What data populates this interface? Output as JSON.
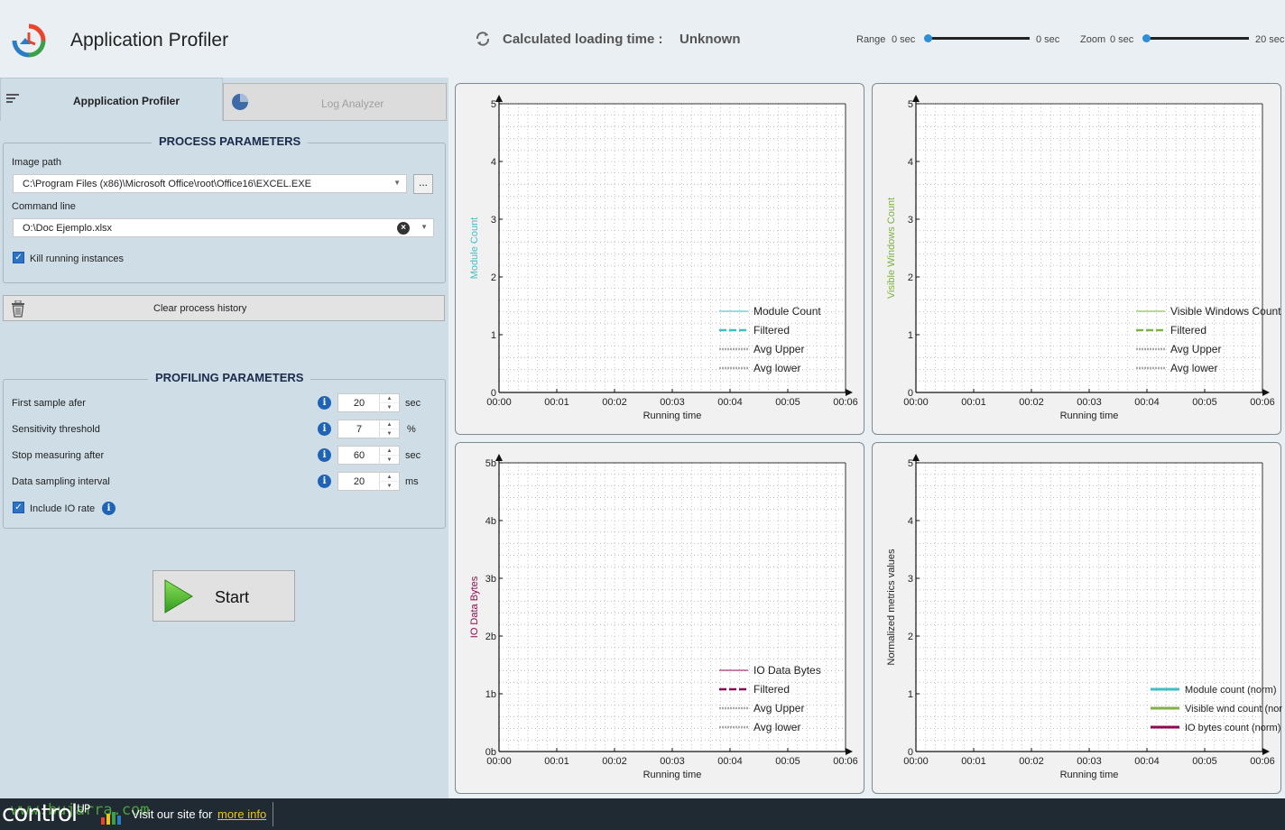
{
  "header": {
    "app_title": "Application Profiler",
    "loading_label": "Calculated loading time :",
    "loading_value": "Unknown",
    "range": {
      "label": "Range",
      "min": "0 sec",
      "max": "0 sec",
      "position": 0.0
    },
    "zoom": {
      "label": "Zoom",
      "min": "0 sec",
      "max": "20 sec",
      "position": 0.0
    }
  },
  "tabs": [
    {
      "label": "Appplication Profiler",
      "active": true
    },
    {
      "label": "Log Analyzer",
      "active": false
    }
  ],
  "process_parameters": {
    "title": "PROCESS PARAMETERS",
    "image_path_label": "Image path",
    "image_path_value": "C:\\Program Files (x86)\\Microsoft Office\\root\\Office16\\EXCEL.EXE",
    "browse_label": "...",
    "command_line_label": "Command line",
    "command_line_value": "O:\\Doc Ejemplo.xlsx",
    "kill_label": "Kill running instances",
    "kill_checked": true
  },
  "clear_history_label": "Clear process history",
  "profiling_parameters": {
    "title": "PROFILING PARAMETERS",
    "rows": [
      {
        "label": "First sample afer",
        "value": "20",
        "unit": "sec"
      },
      {
        "label": "Sensitivity threshold",
        "value": "7",
        "unit": "%"
      },
      {
        "label": "Stop measuring after",
        "value": "60",
        "unit": "sec"
      },
      {
        "label": "Data sampling interval",
        "value": "20",
        "unit": "ms"
      }
    ],
    "include_io_label": "Include IO rate",
    "include_io_checked": true
  },
  "start_label": "Start",
  "footer": {
    "brand": "control",
    "brand_superscript": "UP",
    "text": "Visit our site for",
    "link": "more info",
    "watermark": "www.bujarra.com"
  },
  "colors": {
    "module": "#3ebfc4",
    "visible": "#7cb342",
    "io": "#8b0a50",
    "gray": "#a9a9a9",
    "accent": "#2d8fd6"
  },
  "chart_data": [
    {
      "type": "line",
      "x_ticks": [
        "00:00",
        "00:01",
        "00:02",
        "00:03",
        "00:04",
        "00:05",
        "00:06"
      ],
      "y_ticks": [
        "0",
        "1",
        "2",
        "3",
        "4",
        "5"
      ],
      "ylim": [
        0,
        5
      ],
      "xlabel": "Running time",
      "ylabel": "Module Count",
      "ylabel_color": "#3ebfc4",
      "grid": true,
      "legend_position": "bottom-right",
      "series": [
        {
          "name": "Module Count",
          "color": "#3ebfc4",
          "style": "solid-thin",
          "values": []
        },
        {
          "name": "Filtered",
          "color": "#3ebfc4",
          "style": "dashed",
          "values": []
        },
        {
          "name": "Avg Upper",
          "color": "#a9a9a9",
          "style": "dotted",
          "values": []
        },
        {
          "name": "Avg lower",
          "color": "#a9a9a9",
          "style": "dotted",
          "values": []
        }
      ]
    },
    {
      "type": "line",
      "x_ticks": [
        "00:00",
        "00:01",
        "00:02",
        "00:03",
        "00:04",
        "00:05",
        "00:06"
      ],
      "y_ticks": [
        "0",
        "1",
        "2",
        "3",
        "4",
        "5"
      ],
      "ylim": [
        0,
        5
      ],
      "xlabel": "Running time",
      "ylabel": "Visible Windows Count",
      "ylabel_color": "#7cb342",
      "grid": true,
      "legend_position": "bottom-right",
      "series": [
        {
          "name": "Visible Windows Count",
          "color": "#7cb342",
          "style": "solid-thin",
          "values": []
        },
        {
          "name": "Filtered",
          "color": "#7cb342",
          "style": "dashed",
          "values": []
        },
        {
          "name": "Avg Upper",
          "color": "#a9a9a9",
          "style": "dotted",
          "values": []
        },
        {
          "name": "Avg lower",
          "color": "#a9a9a9",
          "style": "dotted",
          "values": []
        }
      ]
    },
    {
      "type": "line",
      "x_ticks": [
        "00:00",
        "00:01",
        "00:02",
        "00:03",
        "00:04",
        "00:05",
        "00:06"
      ],
      "y_ticks": [
        "0b",
        "1b",
        "2b",
        "3b",
        "4b",
        "5b"
      ],
      "ylim": [
        0,
        5
      ],
      "xlabel": "Running time",
      "ylabel": "IO Data Bytes",
      "ylabel_color": "#8b0a50",
      "grid": true,
      "legend_position": "bottom-right",
      "series": [
        {
          "name": "IO Data Bytes",
          "color": "#8b0a50",
          "style": "solid-thin",
          "values": []
        },
        {
          "name": "Filtered",
          "color": "#8b0a50",
          "style": "dashed",
          "values": []
        },
        {
          "name": "Avg Upper",
          "color": "#a9a9a9",
          "style": "dotted",
          "values": []
        },
        {
          "name": "Avg lower",
          "color": "#a9a9a9",
          "style": "dotted",
          "values": []
        }
      ]
    },
    {
      "type": "line",
      "x_ticks": [
        "00:00",
        "00:01",
        "00:02",
        "00:03",
        "00:04",
        "00:05",
        "00:06"
      ],
      "y_ticks": [
        "0",
        "1",
        "2",
        "3",
        "4",
        "5"
      ],
      "ylim": [
        0,
        5
      ],
      "xlabel": "Running time",
      "ylabel": "Normalized metrics values",
      "ylabel_color": "#222222",
      "grid": true,
      "legend_position": "bottom-right",
      "series": [
        {
          "name": "Module count (norm)",
          "color": "#3ebfc4",
          "style": "solid-thick",
          "values": []
        },
        {
          "name": "Visible wnd count (norm)",
          "color": "#7cb342",
          "style": "solid-thick",
          "values": []
        },
        {
          "name": "IO bytes count (norm)",
          "color": "#8b0a50",
          "style": "solid-thick",
          "values": []
        }
      ]
    }
  ]
}
